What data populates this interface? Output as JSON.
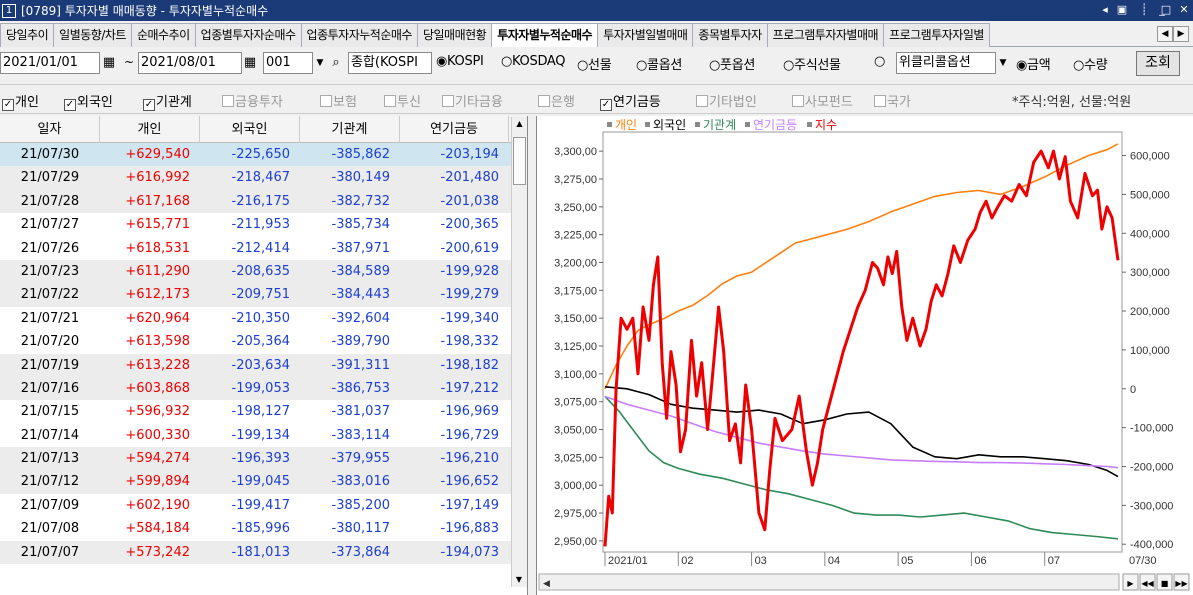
{
  "window": {
    "title": "[0789] 투자자별 매매동향 - 투자자별누적순매수",
    "icon": "1"
  },
  "tabs": [
    {
      "label": "당일추이"
    },
    {
      "label": "일별동향/차트"
    },
    {
      "label": "순매수추이"
    },
    {
      "label": "업종별투자자순매수"
    },
    {
      "label": "업종투자자누적순매수"
    },
    {
      "label": "당일매매현황"
    },
    {
      "label": "투자자별누적순매수",
      "active": true
    },
    {
      "label": "투자자별일별매매"
    },
    {
      "label": "종목별투자자"
    },
    {
      "label": "프로그램투자자별매매"
    },
    {
      "label": "프로그램투자자일별"
    }
  ],
  "filters": {
    "start_date": "2021/01/01",
    "tilde": "~",
    "end_date": "2021/08/01",
    "code": "001",
    "market": "종합(KOSPI",
    "options": [
      "KOSPI",
      "KOSDAQ",
      "선물",
      "콜옵션",
      "풋옵션",
      "주식선물"
    ],
    "selected_option": "KOSPI",
    "weekly": "위클리콜옵션",
    "measures": [
      "금액",
      "수량"
    ],
    "selected_measure": "금액",
    "query_label": "조회"
  },
  "investors": [
    {
      "label": "개인",
      "checked": true
    },
    {
      "label": "외국인",
      "checked": true
    },
    {
      "label": "기관계",
      "checked": true
    },
    {
      "label": "금융투자",
      "checked": false
    },
    {
      "label": "보험",
      "checked": false
    },
    {
      "label": "투신",
      "checked": false
    },
    {
      "label": "기타금융",
      "checked": false
    },
    {
      "label": "은행",
      "checked": false
    },
    {
      "label": "연기금등",
      "checked": true
    },
    {
      "label": "기타법인",
      "checked": false
    },
    {
      "label": "사모펀드",
      "checked": false
    },
    {
      "label": "국가",
      "checked": false
    }
  ],
  "unit_note": "*주식:억원, 선물:억원",
  "table": {
    "headers": [
      "일자",
      "개인",
      "외국인",
      "기관계",
      "연기금등"
    ],
    "rows": [
      [
        "21/07/30",
        "+629,540",
        "-225,650",
        "-385,862",
        "-203,194"
      ],
      [
        "21/07/29",
        "+616,992",
        "-218,467",
        "-380,149",
        "-201,480"
      ],
      [
        "21/07/28",
        "+617,168",
        "-216,175",
        "-382,732",
        "-201,038"
      ],
      [
        "21/07/27",
        "+615,771",
        "-211,953",
        "-385,734",
        "-200,365"
      ],
      [
        "21/07/26",
        "+618,531",
        "-212,414",
        "-387,971",
        "-200,619"
      ],
      [
        "21/07/23",
        "+611,290",
        "-208,635",
        "-384,589",
        "-199,928"
      ],
      [
        "21/07/22",
        "+612,173",
        "-209,751",
        "-384,443",
        "-199,279"
      ],
      [
        "21/07/21",
        "+620,964",
        "-210,350",
        "-392,604",
        "-199,340"
      ],
      [
        "21/07/20",
        "+613,598",
        "-205,364",
        "-389,790",
        "-198,332"
      ],
      [
        "21/07/19",
        "+613,228",
        "-203,634",
        "-391,311",
        "-198,182"
      ],
      [
        "21/07/16",
        "+603,868",
        "-199,053",
        "-386,753",
        "-197,212"
      ],
      [
        "21/07/15",
        "+596,932",
        "-198,127",
        "-381,037",
        "-196,969"
      ],
      [
        "21/07/14",
        "+600,330",
        "-199,134",
        "-383,114",
        "-196,729"
      ],
      [
        "21/07/13",
        "+594,274",
        "-196,393",
        "-379,955",
        "-196,210"
      ],
      [
        "21/07/12",
        "+599,894",
        "-199,045",
        "-383,016",
        "-196,652"
      ],
      [
        "21/07/09",
        "+602,190",
        "-199,417",
        "-385,200",
        "-197,149"
      ],
      [
        "21/07/08",
        "+584,184",
        "-185,996",
        "-380,117",
        "-196,883"
      ],
      [
        "21/07/07",
        "+573,242",
        "-181,013",
        "-373,864",
        "-194,073"
      ]
    ]
  },
  "chart_data": {
    "type": "line",
    "legend": [
      {
        "name": "개인",
        "color": "#ff7f0e"
      },
      {
        "name": "외국인",
        "color": "#000000"
      },
      {
        "name": "기관계",
        "color": "#2e8b57"
      },
      {
        "name": "연기금등",
        "color": "#c77dff"
      },
      {
        "name": "지수",
        "color": "#ee0000"
      }
    ],
    "left_axis": {
      "ticks": [
        "3,300,00",
        "3,275,00",
        "3,250,00",
        "3,225,00",
        "3,200,00",
        "3,175,00",
        "3,150,00",
        "3,125,00",
        "3,100,00",
        "3,075,00",
        "3,050,00",
        "3,025,00",
        "3,000,00",
        "2,975,00",
        "2,950,00"
      ],
      "range": [
        2940,
        3310
      ]
    },
    "right_axis": {
      "ticks": [
        "600,000",
        "500,000",
        "400,000",
        "300,000",
        "200,000",
        "100,000",
        "0",
        "-100,000",
        "-200,000",
        "-300,000",
        "-400,000"
      ],
      "range": [
        -420000,
        640000
      ]
    },
    "x_ticks": [
      "2021/01",
      "02",
      "03",
      "04",
      "05",
      "06",
      "07",
      "07/30"
    ],
    "x_range": [
      0,
      7
    ],
    "series": [
      {
        "name": "개인",
        "axis": "right",
        "color": "#ff7f0e",
        "points": [
          [
            0,
            0
          ],
          [
            0.15,
            60000
          ],
          [
            0.3,
            110000
          ],
          [
            0.45,
            150000
          ],
          [
            0.6,
            165000
          ],
          [
            0.8,
            180000
          ],
          [
            1,
            200000
          ],
          [
            1.2,
            215000
          ],
          [
            1.4,
            240000
          ],
          [
            1.6,
            270000
          ],
          [
            1.8,
            290000
          ],
          [
            2,
            300000
          ],
          [
            2.2,
            325000
          ],
          [
            2.4,
            350000
          ],
          [
            2.6,
            375000
          ],
          [
            2.8,
            385000
          ],
          [
            3,
            395000
          ],
          [
            3.3,
            410000
          ],
          [
            3.6,
            430000
          ],
          [
            3.9,
            455000
          ],
          [
            4.2,
            475000
          ],
          [
            4.5,
            495000
          ],
          [
            4.8,
            505000
          ],
          [
            5.1,
            510000
          ],
          [
            5.4,
            500000
          ],
          [
            5.7,
            520000
          ],
          [
            6,
            545000
          ],
          [
            6.3,
            575000
          ],
          [
            6.6,
            600000
          ],
          [
            6.85,
            615000
          ],
          [
            7,
            630000
          ]
        ]
      },
      {
        "name": "외국인",
        "axis": "right",
        "color": "#000000",
        "points": [
          [
            0,
            5000
          ],
          [
            0.3,
            0
          ],
          [
            0.6,
            -15000
          ],
          [
            0.9,
            -40000
          ],
          [
            1.2,
            -50000
          ],
          [
            1.5,
            -55000
          ],
          [
            1.8,
            -60000
          ],
          [
            2.1,
            -55000
          ],
          [
            2.4,
            -65000
          ],
          [
            2.7,
            -90000
          ],
          [
            3,
            -80000
          ],
          [
            3.3,
            -65000
          ],
          [
            3.6,
            -60000
          ],
          [
            3.9,
            -90000
          ],
          [
            4.2,
            -150000
          ],
          [
            4.5,
            -175000
          ],
          [
            4.8,
            -180000
          ],
          [
            5.1,
            -170000
          ],
          [
            5.4,
            -175000
          ],
          [
            5.7,
            -175000
          ],
          [
            6,
            -180000
          ],
          [
            6.3,
            -185000
          ],
          [
            6.6,
            -195000
          ],
          [
            6.85,
            -210000
          ],
          [
            7,
            -226000
          ]
        ]
      },
      {
        "name": "기관계",
        "axis": "right",
        "color": "#2e8b57",
        "points": [
          [
            0,
            -20000
          ],
          [
            0.2,
            -60000
          ],
          [
            0.4,
            -110000
          ],
          [
            0.6,
            -160000
          ],
          [
            0.8,
            -190000
          ],
          [
            1,
            -205000
          ],
          [
            1.3,
            -220000
          ],
          [
            1.6,
            -230000
          ],
          [
            1.9,
            -245000
          ],
          [
            2.2,
            -260000
          ],
          [
            2.5,
            -270000
          ],
          [
            2.8,
            -285000
          ],
          [
            3.1,
            -300000
          ],
          [
            3.4,
            -320000
          ],
          [
            3.7,
            -325000
          ],
          [
            4,
            -325000
          ],
          [
            4.3,
            -330000
          ],
          [
            4.6,
            -325000
          ],
          [
            4.9,
            -320000
          ],
          [
            5.2,
            -330000
          ],
          [
            5.5,
            -340000
          ],
          [
            5.8,
            -360000
          ],
          [
            6.1,
            -370000
          ],
          [
            6.4,
            -375000
          ],
          [
            6.7,
            -380000
          ],
          [
            7,
            -386000
          ]
        ]
      },
      {
        "name": "연기금등",
        "axis": "right",
        "color": "#c77dff",
        "points": [
          [
            0,
            -20000
          ],
          [
            0.3,
            -40000
          ],
          [
            0.6,
            -55000
          ],
          [
            0.9,
            -70000
          ],
          [
            1.2,
            -90000
          ],
          [
            1.5,
            -110000
          ],
          [
            1.8,
            -125000
          ],
          [
            2.1,
            -140000
          ],
          [
            2.4,
            -150000
          ],
          [
            2.7,
            -160000
          ],
          [
            3,
            -168000
          ],
          [
            3.3,
            -173000
          ],
          [
            3.6,
            -178000
          ],
          [
            3.9,
            -183000
          ],
          [
            4.2,
            -185000
          ],
          [
            4.5,
            -187000
          ],
          [
            4.8,
            -188000
          ],
          [
            5.1,
            -190000
          ],
          [
            5.4,
            -190000
          ],
          [
            5.7,
            -191000
          ],
          [
            6,
            -193000
          ],
          [
            6.3,
            -195000
          ],
          [
            6.6,
            -198000
          ],
          [
            6.85,
            -200000
          ],
          [
            7,
            -203000
          ]
        ]
      },
      {
        "name": "지수",
        "axis": "left",
        "color": "#ee0000",
        "points": [
          [
            0,
            2945
          ],
          [
            0.05,
            2990
          ],
          [
            0.1,
            2975
          ],
          [
            0.15,
            3085
          ],
          [
            0.22,
            3150
          ],
          [
            0.3,
            3140
          ],
          [
            0.38,
            3150
          ],
          [
            0.45,
            3100
          ],
          [
            0.52,
            3160
          ],
          [
            0.6,
            3130
          ],
          [
            0.66,
            3180
          ],
          [
            0.72,
            3205
          ],
          [
            0.78,
            3110
          ],
          [
            0.84,
            3060
          ],
          [
            0.9,
            3120
          ],
          [
            0.97,
            3090
          ],
          [
            1.03,
            3030
          ],
          [
            1.1,
            3050
          ],
          [
            1.18,
            3130
          ],
          [
            1.25,
            3080
          ],
          [
            1.32,
            3110
          ],
          [
            1.4,
            3050
          ],
          [
            1.47,
            3100
          ],
          [
            1.55,
            3160
          ],
          [
            1.62,
            3120
          ],
          [
            1.7,
            3040
          ],
          [
            1.78,
            3055
          ],
          [
            1.85,
            3020
          ],
          [
            1.92,
            3090
          ],
          [
            2,
            3050
          ],
          [
            2.1,
            2975
          ],
          [
            2.18,
            2960
          ],
          [
            2.25,
            3015
          ],
          [
            2.32,
            3060
          ],
          [
            2.42,
            3040
          ],
          [
            2.55,
            3050
          ],
          [
            2.65,
            3080
          ],
          [
            2.75,
            3030
          ],
          [
            2.83,
            3000
          ],
          [
            2.9,
            3020
          ],
          [
            2.97,
            3050
          ],
          [
            3.05,
            3070
          ],
          [
            3.15,
            3095
          ],
          [
            3.25,
            3120
          ],
          [
            3.35,
            3140
          ],
          [
            3.45,
            3160
          ],
          [
            3.55,
            3175
          ],
          [
            3.65,
            3200
          ],
          [
            3.72,
            3195
          ],
          [
            3.8,
            3180
          ],
          [
            3.86,
            3205
          ],
          [
            3.92,
            3190
          ],
          [
            3.98,
            3210
          ],
          [
            4.05,
            3160
          ],
          [
            4.12,
            3130
          ],
          [
            4.2,
            3150
          ],
          [
            4.3,
            3125
          ],
          [
            4.38,
            3140
          ],
          [
            4.45,
            3165
          ],
          [
            4.52,
            3180
          ],
          [
            4.6,
            3170
          ],
          [
            4.68,
            3190
          ],
          [
            4.76,
            3215
          ],
          [
            4.85,
            3200
          ],
          [
            4.95,
            3220
          ],
          [
            5.05,
            3230
          ],
          [
            5.12,
            3245
          ],
          [
            5.2,
            3255
          ],
          [
            5.28,
            3240
          ],
          [
            5.36,
            3250
          ],
          [
            5.45,
            3260
          ],
          [
            5.55,
            3255
          ],
          [
            5.65,
            3270
          ],
          [
            5.75,
            3260
          ],
          [
            5.85,
            3290
          ],
          [
            5.95,
            3300
          ],
          [
            6.05,
            3285
          ],
          [
            6.12,
            3300
          ],
          [
            6.2,
            3275
          ],
          [
            6.28,
            3295
          ],
          [
            6.35,
            3255
          ],
          [
            6.45,
            3240
          ],
          [
            6.55,
            3280
          ],
          [
            6.65,
            3260
          ],
          [
            6.72,
            3265
          ],
          [
            6.78,
            3230
          ],
          [
            6.85,
            3250
          ],
          [
            6.92,
            3240
          ],
          [
            7,
            3202
          ]
        ]
      }
    ]
  }
}
